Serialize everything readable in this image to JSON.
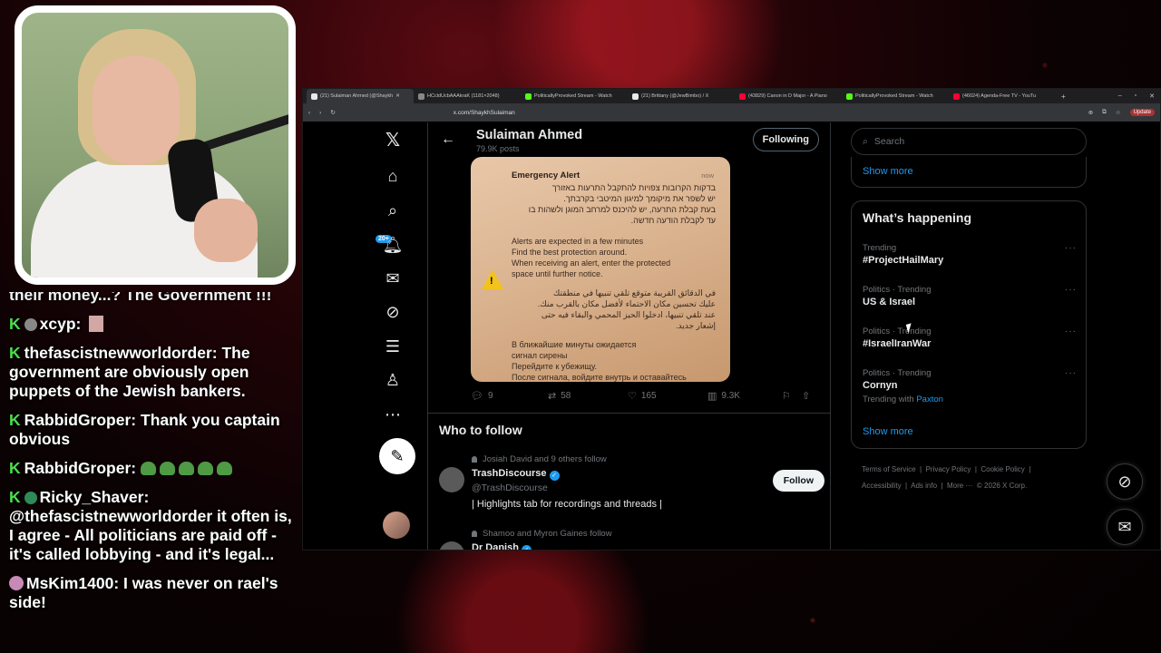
{
  "chat": {
    "messages": [
      {
        "user": "",
        "text": "their money...? The Government !!!"
      },
      {
        "user": "xcyp",
        "text": ""
      },
      {
        "user": "thefascistnewworldorder",
        "text": "The government are obviously open puppets of the Jewish bankers."
      },
      {
        "user": "RabbidGroper",
        "text": "Thank you captain obvious"
      },
      {
        "user": "RabbidGroper",
        "text": ""
      },
      {
        "user": "Ricky_Shaver",
        "text": "@thefascistnewworldorder it often is, I agree - All politicians are paid off - it's called lobbying - and it's legal..."
      },
      {
        "user": "MsKim1400",
        "text": "I was never on rael's side!"
      }
    ]
  },
  "browser": {
    "tabs": [
      {
        "title": "(21) Sulaiman Ahmed (@Shaykh",
        "color": "#e7e9ea"
      },
      {
        "title": "HCcldUcbAAAkraK (1181×2048)",
        "color": "#888888"
      },
      {
        "title": "PoliticallyProvoked Stream - Watch",
        "color": "#53fc18"
      },
      {
        "title": "(21) Brittany (@JewBimbo) / X",
        "color": "#e7e9ea"
      },
      {
        "title": "(43829) Canon in D Major - A Piano",
        "color": "#ff0033"
      },
      {
        "title": "PoliticallyProvoked Stream - Watch",
        "color": "#53fc18"
      },
      {
        "title": "(46024) Agenda-Free TV - YouTu",
        "color": "#ff0033"
      }
    ],
    "url": "x.com/ShaykhSulaiman",
    "update_label": "Update"
  },
  "nav": {
    "notif_count": "20+"
  },
  "profile": {
    "name": "Sulaiman Ahmed",
    "posts": "79.9K posts",
    "following_label": "Following"
  },
  "alert": {
    "title": "Emergency Alert",
    "time": "now",
    "hebrew": "בדקות הקרובות צפויות להתקבל התרעות באזורך\nיש לשפר את מיקומך למיגון המיטבי בקרבתך.\nבעת קבלת התרעה, יש להיכנס למרחב המוגן ולשהות בו\nעד לקבלת הודעה חדשה.",
    "english": "Alerts are expected in a few minutes\nFind the best protection around.\nWhen receiving an alert, enter the protected\nspace until further notice.",
    "arabic": "في الدقائق القريبة متوقع تلقي تنبيها في منطقتك\nعليك تحسين مكان الاحتماء لأفضل مكان بالقرب منك.\nعند تلقي تنبيها، ادخلوا الحيز المحمي والبقاء فيه حتى\nإشعار جديد.",
    "russian": "В ближайшие минуты ожидается\nсигнал сирены\nПерейдите к убежищу.\nПосле сигнала, войдите внутрь и оставайтесь"
  },
  "post_actions": {
    "replies": "9",
    "reposts": "58",
    "likes": "165",
    "views": "9.3K"
  },
  "who_to_follow": {
    "title": "Who to follow",
    "suggestions": [
      {
        "context": "Josiah David and 9 others follow",
        "name": "TrashDiscourse",
        "handle": "@TrashDiscourse",
        "bio": "| Highlights tab for recordings and threads |",
        "follow_label": "Follow"
      },
      {
        "context": "Shamoo and Myron Gaines follow",
        "name": "Dr Danish",
        "handle": "",
        "bio": "",
        "follow_label": "Follow"
      }
    ]
  },
  "right": {
    "search_placeholder": "Search",
    "show_more_top": "Show more",
    "whats_happening": "What’s happening",
    "trends": [
      {
        "category": "Trending",
        "title": "#ProjectHailMary",
        "with_label": "",
        "with_link": ""
      },
      {
        "category": "Politics · Trending",
        "title": "US & Israel",
        "with_label": "",
        "with_link": ""
      },
      {
        "category": "Politics · Trending",
        "title": "#IsraelIranWar",
        "with_label": "",
        "with_link": ""
      },
      {
        "category": "Politics · Trending",
        "title": "Cornyn",
        "with_label": "Trending with",
        "with_link": "Paxton"
      }
    ],
    "show_more_bottom": "Show more",
    "footer": [
      "Terms of Service",
      "|",
      "Privacy Policy",
      "|",
      "Cookie Policy",
      "|",
      "Accessibility",
      "|",
      "Ads info",
      "|",
      "More ···",
      "© 2026 X Corp."
    ]
  }
}
